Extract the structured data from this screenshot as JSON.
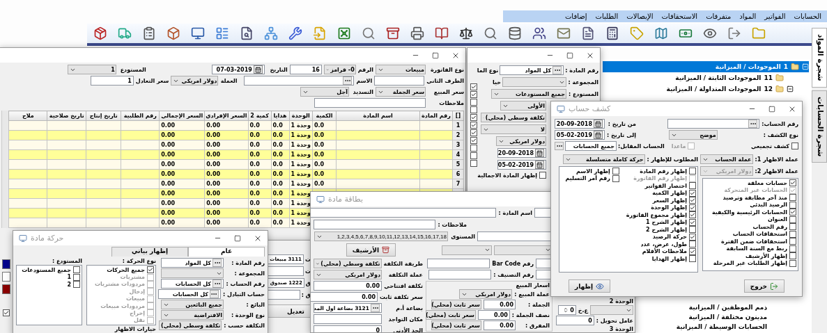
{
  "menu": [
    "الحسابات",
    "الفواتير",
    "المواد",
    "متفرقات",
    "الاستحقاقات",
    "الإيصالات",
    "الطلبات",
    "إضافات"
  ],
  "tree_tabs": [
    {
      "label": "شجرة المواد",
      "selected": true
    },
    {
      "label": "شجرة الحسابات",
      "selected": false
    }
  ],
  "tree": [
    {
      "number": "1",
      "label": "الموجودات / الميزانية",
      "selected": true,
      "expanded": true,
      "children": [
        {
          "number": "11",
          "label": "الموجودات الثابتة / الميزانية",
          "selected": false,
          "expanded": false
        },
        {
          "number": "12",
          "label": "الموجودات المتداولة / الميزانية",
          "selected": false,
          "expanded": true
        }
      ]
    }
  ],
  "tree_lower": [
    "ذمم الموظفين / الميزانية",
    "مدينون مختلفة / الميزانية",
    "الحسابات الوسيطة / الميزانية"
  ],
  "invoice": {
    "type_label": "نوع الفاتورة",
    "type": "مبيعات",
    "party_label": "الطرف الثاني",
    "price_label": "سعر المبيع",
    "price": "سعر الجملة",
    "notes_label": "ملاحظات",
    "number_label": "الرقم",
    "number_series": "0- قرامز",
    "number": "16",
    "date_label": "التاريخ",
    "date": "07-03-2019",
    "name_label": "الاسم",
    "payment_label": "التسديد",
    "payment": "آجل",
    "warehouse_label": "المستودع",
    "warehouse": "1",
    "currency_label": "العملة",
    "currency": "دولار امريكي",
    "rate_label": "سعر التعادل",
    "rate": "1",
    "columns": [
      "[]",
      "رقم المادة",
      "اسم المادة",
      "الكمية",
      "الوحدة",
      "هدايا",
      "كمية 2",
      "السعر الإفرادي",
      "السعر الإجمالي",
      "رقم الطلبية",
      "تاريخ إنتاج",
      "تاريخ صلاحية",
      "ملاح"
    ],
    "rows": [
      [
        "1",
        null,
        null,
        "0.0",
        "وحدة 1",
        "0.0",
        "0.0",
        "0.00",
        "0.00",
        null,
        null,
        null,
        null
      ],
      [
        "2",
        null,
        null,
        "0.0",
        "وحدة 1",
        "0.0",
        "0.0",
        "0.00",
        "0.00",
        null,
        null,
        null,
        null
      ],
      [
        "3",
        null,
        null,
        "0.0",
        "وحدة 1",
        "0.0",
        "0.0",
        "0.00",
        "0.00",
        null,
        null,
        null,
        null
      ],
      [
        "4",
        null,
        null,
        "0.0",
        "وحدة 1",
        "0.0",
        "0.0",
        "0.00",
        "0.00",
        null,
        null,
        null,
        null
      ],
      [
        "5",
        null,
        null,
        "0.0",
        "وحدة 1",
        "0.0",
        "0.0",
        "0.00",
        "0.00",
        null,
        null,
        null,
        null
      ],
      [
        "6",
        null,
        null,
        "0.0",
        "وحدة 1",
        "0.0",
        "0.0",
        "0.00",
        "0.00",
        null,
        null,
        null,
        null
      ],
      [
        "7",
        null,
        null,
        "0.0",
        "وحدة 1",
        "0.0",
        "0.0",
        "0.00",
        "0.00",
        null,
        null,
        null,
        null
      ],
      [
        null,
        null,
        null,
        null,
        "وحدة 1",
        "0.0",
        "0.0",
        "0.00",
        "0.00",
        null,
        null,
        null,
        null
      ],
      [
        null,
        null,
        null,
        null,
        "وحدة 1",
        "0.0",
        "0.0",
        "0.00",
        "0.00",
        null,
        null,
        null,
        null
      ],
      [
        null,
        null,
        null,
        null,
        "وحدة 1",
        "0.0",
        "0.0",
        "0.00",
        "0.00",
        null,
        null,
        null,
        null
      ],
      [
        null,
        null,
        null,
        null,
        "وحدة 1",
        "0.0",
        "0.0",
        "0.00",
        "0.00",
        null,
        null,
        null,
        null
      ]
    ]
  },
  "report": {
    "item_label": "رقم المادة :",
    "item": "كل المواد",
    "group_label": "المجموعة :",
    "store_label": "المستودع :",
    "store": "جميع المستودعات",
    "level": "الأولى",
    "cost": "تكلفة وسطي (محلي)",
    "option": "لا",
    "currency": "دولار امريكي",
    "from": "20-09-2018",
    "to": "05-02-2019",
    "total_label": "إظهار المادة الاجمالية",
    "total_checked": false,
    "side_label": "نوع الما",
    "side_label_2": "خيا",
    "side_checks": [
      {
        "checked": true
      },
      {
        "checked": true
      },
      {
        "checked": false
      },
      {
        "checked": false
      },
      {
        "checked": true
      },
      {
        "checked": true
      },
      {
        "checked": true
      },
      {
        "checked": true
      },
      {
        "checked": false
      },
      {
        "checked": false
      },
      {
        "checked": false
      }
    ]
  },
  "statement": {
    "title": "كشف حساب",
    "account_label": "رقم الحساب:",
    "type_label": "نوع الكشف :",
    "type": "موضح",
    "summary_label": "كشف تجميعي",
    "summary_checked": false,
    "from_label": "من تاريخ :",
    "from": "20-09-2018",
    "to_label": "إلى تاريخ :",
    "to": "05-02-2019",
    "except_label": "ماعدا",
    "except_checked": false,
    "except_disabled": true,
    "counter_label": "الحساب المقابل:",
    "counter": "جميع الحسابات",
    "required_label": "المطلوب للإظهار :",
    "required": "حركة كاملة متسلسلة",
    "currency1_label": "عملة الاظهار 1:",
    "currency1": "عملة الحساب",
    "currency2_label": "عملة الاظهار 2:",
    "currency2": "دولار امريكي",
    "currency2_disabled": true,
    "options": [
      {
        "label": "إظهار رقم المادة",
        "checked": false,
        "disabled": false
      },
      {
        "label": "إظهار رقم الفاتورة",
        "checked": false,
        "disabled": true
      },
      {
        "label": "اختصار الفواتير",
        "checked": false,
        "disabled": false
      },
      {
        "label": "إظهار الكمية",
        "checked": true,
        "disabled": false
      },
      {
        "label": "إظهار السعر",
        "checked": true,
        "disabled": false
      },
      {
        "label": "إظهار الوحدة",
        "checked": true,
        "disabled": false
      },
      {
        "label": "إظهار مجموع الفاتورة",
        "checked": true,
        "disabled": false
      },
      {
        "label": "إظهار الشرح 1",
        "checked": true,
        "disabled": false
      },
      {
        "label": "إظهار الشرح 2",
        "checked": false,
        "disabled": false
      },
      {
        "label": "حركة الرصيد",
        "checked": true,
        "disabled": false
      },
      {
        "label": "طول، عرض، عدد",
        "checked": false,
        "disabled": false
      },
      {
        "label": "ملاحظات الأقلام",
        "checked": true,
        "disabled": false
      },
      {
        "label": "إظهار الهدايا",
        "checked": false,
        "disabled": false
      }
    ],
    "options_2": [
      {
        "label": "إظهار الاسم",
        "checked": false,
        "disabled": false
      },
      {
        "label": "رقم أمر التسليم",
        "checked": false,
        "disabled": false
      }
    ],
    "account_options": [
      {
        "label": "حسابات مغلقة",
        "checked": true,
        "disabled": false
      },
      {
        "label": "الحسابات غير المتحركة",
        "checked": true,
        "disabled": true
      },
      {
        "label": "منذ آخر مطابقة وترصيد",
        "checked": false,
        "disabled": false
      },
      {
        "label": "الرصيد البدئي",
        "checked": false,
        "disabled": false
      },
      {
        "label": "الحسابات الرئيسية والكيفية",
        "checked": true,
        "disabled": false
      },
      {
        "label": "العنوان",
        "checked": false,
        "disabled": false
      },
      {
        "label": "رقم الحساب",
        "checked": false,
        "disabled": false
      },
      {
        "label": "استحقاقات الحساب",
        "checked": false,
        "disabled": false
      },
      {
        "label": "استحقاقات ضمن الفترة",
        "checked": false,
        "disabled": false
      },
      {
        "label": "ربط مع السنة السابقة",
        "checked": false,
        "disabled": false
      },
      {
        "label": "إظهار الأرشيف",
        "checked": false,
        "disabled": false
      },
      {
        "label": "إظهار الطلبات غير المرحلة",
        "checked": false,
        "disabled": false
      }
    ],
    "buttons": [
      {
        "label": "خروج",
        "kind": "exit"
      },
      {
        "label": "إظهار",
        "kind": "show"
      }
    ]
  },
  "card": {
    "title": "بطاقة مادة",
    "name_label": "اسم المادة :",
    "notes_label": "ملاحظات :",
    "level_label": "المستوى",
    "levels": "1,2,3,4,5,6,7,8,9,10,11,12,13,14,15,16,17,18",
    "archive": "الأرشيف",
    "barcode_label": "رقم Bar Code",
    "class_label": "رقم التصنيف :",
    "prices_title": "اسعار المبيع",
    "sale_currency_label": "عملة المبيع :",
    "sale_currency": "دولار امريكي",
    "prices": [
      {
        "label": "الجملة :",
        "value": "0.00",
        "mode": "سعر ثابت (محلي)"
      },
      {
        "label": "نصف الجملة :",
        "value": "0.00",
        "mode": "سعر ثابت (محلي)"
      },
      {
        "label": "المفرق :",
        "value": "0.00",
        "mode": "سعر ثابت (محلي)"
      }
    ],
    "cost": [
      {
        "label": "طريقة التكلفة",
        "value": "تكلفة وسطي (محلي)",
        "kind": "combo"
      },
      {
        "label": "عملة التكلفة",
        "value": "دولار امريكي",
        "kind": "combo"
      },
      {
        "label": "تكلفة افتتاحي",
        "value": "0.00",
        "kind": "field"
      },
      {
        "label": "سعر تكلفة ثابت",
        "value": "0.00",
        "kind": "field"
      },
      {
        "label": "بضاعة أ.م",
        "value": "3121 بضاعة اول المد",
        "kind": "lookup"
      },
      {
        "label": "مكان التواجد",
        "kind": "field"
      },
      {
        "label": "الحد الأدنى",
        "value": "0",
        "kind": "field"
      }
    ],
    "unit2_label": "الوحدة 2",
    "unit_step_label": "ع.خ",
    "unit_step": "0",
    "factor_label": "عامل تحويل :",
    "factor": "0",
    "unit3_label": "الوحدة 3"
  },
  "behind": {
    "fields": [
      {
        "label": "ت",
        "value": "3111 مبيعات"
      },
      {
        "label": "ت"
      },
      {
        "label": "ق",
        "value": "1222 صندوق"
      },
      {
        "label": "ق :"
      }
    ],
    "button": "تعديل"
  },
  "movement": {
    "title": "حركة مادة",
    "tabs": [
      {
        "label": "عام",
        "selected": true
      },
      {
        "label": "إظهار بياني",
        "selected": false
      }
    ],
    "fields": [
      {
        "label": "رقم المادة :",
        "value": "كل المواد",
        "kind": "lookup"
      },
      {
        "label": "المجموعة :",
        "kind": "combo"
      },
      {
        "label": "رقم الحساب :",
        "value": "كل الحسابات",
        "kind": "lookup"
      },
      {
        "label": "حساب التبادل :",
        "value": "كل الحسابات",
        "kind": "lookup"
      },
      {
        "label": "البائع :",
        "value": "جميع البائعين",
        "kind": "combo"
      },
      {
        "label": "نوع الوحدة :",
        "value": "الافتراضية",
        "kind": "combo"
      },
      {
        "label": "التكلفة حسب :",
        "value": "تكلفة وسطي (محلي)",
        "kind": "combo"
      }
    ],
    "move_label": "نوع الحركة :",
    "moves": [
      {
        "label": "جميع الحركات",
        "checked": true,
        "disabled": false
      },
      {
        "label": "مشتريات",
        "checked": false,
        "disabled": true
      },
      {
        "label": "مردودات مشتريات",
        "checked": false,
        "disabled": true
      },
      {
        "label": "إدخال",
        "checked": false,
        "disabled": true
      },
      {
        "label": "مبيعات",
        "checked": false,
        "disabled": true
      },
      {
        "label": "مردودات مبيعات",
        "checked": false,
        "disabled": true
      },
      {
        "label": "إخراج",
        "checked": false,
        "disabled": true
      },
      {
        "label": "نقل",
        "checked": false,
        "disabled": true
      }
    ],
    "store_label": "المستودع :",
    "stores": [
      {
        "label": "جميع المستودعات",
        "checked": false
      },
      {
        "label": "1",
        "checked": false
      },
      {
        "label": "2",
        "checked": false
      }
    ],
    "options_label": "خيارات الاظهار"
  },
  "edge": {
    "swatches": [
      {
        "color": "#00008b"
      },
      {
        "color": "#ffffff"
      },
      {
        "color": "#8b0000"
      }
    ],
    "checked": true
  }
}
